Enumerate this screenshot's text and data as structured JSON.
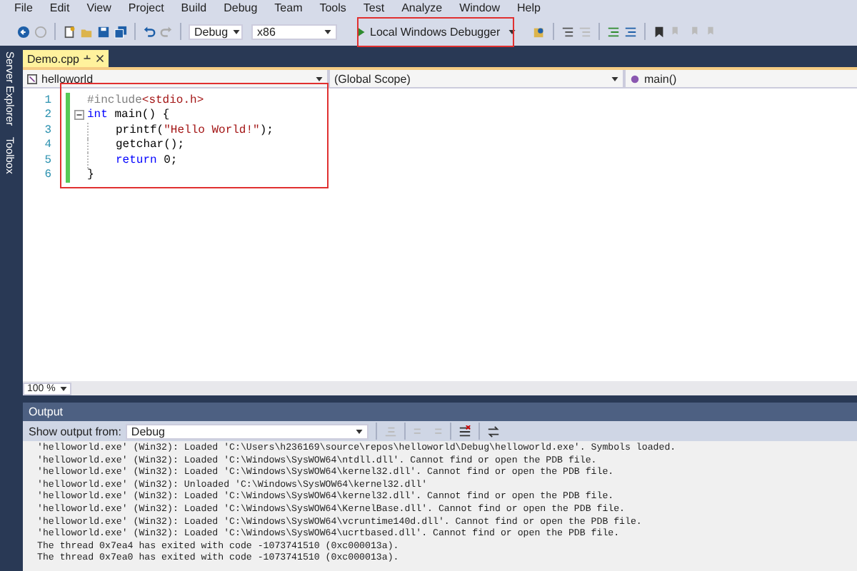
{
  "menu": [
    "File",
    "Edit",
    "View",
    "Project",
    "Build",
    "Debug",
    "Team",
    "Tools",
    "Test",
    "Analyze",
    "Window",
    "Help"
  ],
  "toolbar": {
    "configuration": "Debug",
    "platform": "x86",
    "debugger": "Local Windows Debugger"
  },
  "side_tabs": [
    "Server Explorer",
    "Toolbox"
  ],
  "document_tab": {
    "label": "Demo.cpp",
    "selected": true
  },
  "nav_bar": {
    "project": "helloworld",
    "scope": "(Global Scope)",
    "member": "main()"
  },
  "code": [
    {
      "number": "1",
      "tokens": [
        {
          "kind": "preproc",
          "text": "#include"
        },
        {
          "kind": "string",
          "text": "<stdio.h>"
        }
      ]
    },
    {
      "number": "2",
      "fold": true,
      "tokens": [
        {
          "kind": "keyword",
          "text": "int"
        },
        {
          "kind": "plain",
          "text": " main() {"
        }
      ]
    },
    {
      "number": "3",
      "indented": true,
      "tokens": [
        {
          "kind": "plain",
          "text": "printf("
        },
        {
          "kind": "string",
          "text": "\"Hello World!\""
        },
        {
          "kind": "plain",
          "text": ");"
        }
      ]
    },
    {
      "number": "4",
      "indented": true,
      "tokens": [
        {
          "kind": "plain",
          "text": "getchar();"
        }
      ]
    },
    {
      "number": "5",
      "indented": true,
      "tokens": [
        {
          "kind": "keyword",
          "text": "return"
        },
        {
          "kind": "plain",
          "text": " 0;"
        }
      ]
    },
    {
      "number": "6",
      "tokens": [
        {
          "kind": "plain",
          "text": "}"
        }
      ]
    }
  ],
  "zoom": "100 %",
  "output": {
    "title": "Output",
    "source_label": "Show output from:",
    "source": "Debug",
    "lines": [
      "'helloworld.exe' (Win32): Loaded 'C:\\Users\\h236169\\source\\repos\\helloworld\\Debug\\helloworld.exe'. Symbols loaded.",
      "'helloworld.exe' (Win32): Loaded 'C:\\Windows\\SysWOW64\\ntdll.dll'. Cannot find or open the PDB file.",
      "'helloworld.exe' (Win32): Loaded 'C:\\Windows\\SysWOW64\\kernel32.dll'. Cannot find or open the PDB file.",
      "'helloworld.exe' (Win32): Unloaded 'C:\\Windows\\SysWOW64\\kernel32.dll'",
      "'helloworld.exe' (Win32): Loaded 'C:\\Windows\\SysWOW64\\kernel32.dll'. Cannot find or open the PDB file.",
      "'helloworld.exe' (Win32): Loaded 'C:\\Windows\\SysWOW64\\KernelBase.dll'. Cannot find or open the PDB file.",
      "'helloworld.exe' (Win32): Loaded 'C:\\Windows\\SysWOW64\\vcruntime140d.dll'. Cannot find or open the PDB file.",
      "'helloworld.exe' (Win32): Loaded 'C:\\Windows\\SysWOW64\\ucrtbased.dll'. Cannot find or open the PDB file.",
      "The thread 0x7ea4 has exited with code -1073741510 (0xc000013a).",
      "The thread 0x7ea0 has exited with code -1073741510 (0xc000013a)."
    ]
  }
}
